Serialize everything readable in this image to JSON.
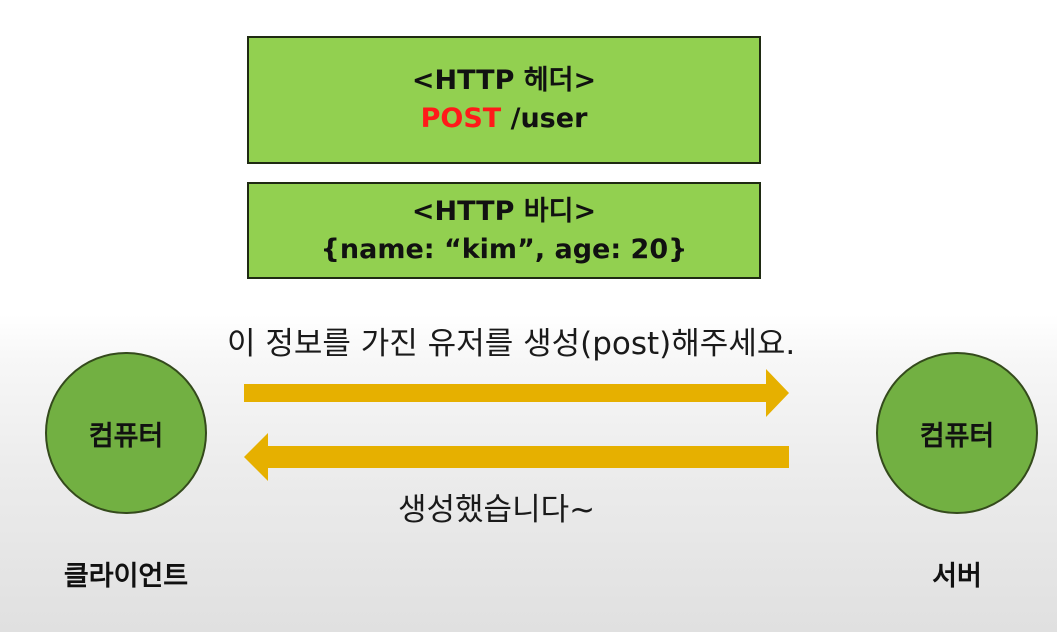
{
  "http_header": {
    "title": "<HTTP 헤더>",
    "method": "POST",
    "path": " /user",
    "method_color": "#ff1a1a"
  },
  "http_body": {
    "title": "<HTTP 바디>",
    "content": "{name: “kim”, age: 20}"
  },
  "request": {
    "caption": "이 정보를 가진 유저를 생성(post)해주세요.",
    "direction": "client-to-server"
  },
  "response": {
    "caption": "생성했습니다~",
    "direction": "server-to-client"
  },
  "client": {
    "node_label": "컴퓨터",
    "role": "클라이언트"
  },
  "server": {
    "node_label": "컴퓨터",
    "role": "서버"
  },
  "colors": {
    "box_fill": "#92d050",
    "node_fill": "#72b042",
    "arrow": "#e6b000"
  }
}
